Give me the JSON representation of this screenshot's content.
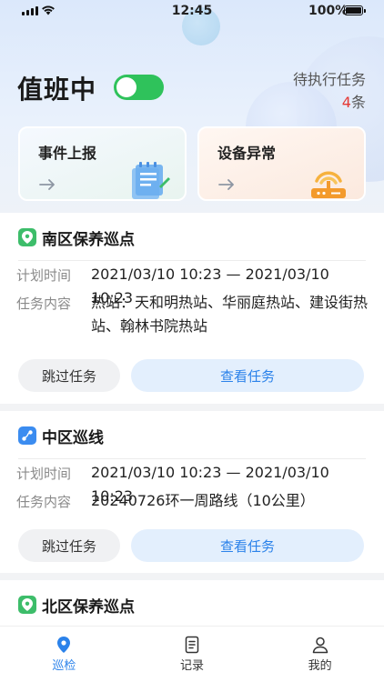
{
  "status_bar": {
    "time": "12:45",
    "battery": "100%"
  },
  "header": {
    "duty_label": "值班中",
    "duty_on": true,
    "pending_label": "待执行任务",
    "pending_count": "4",
    "pending_unit": "条"
  },
  "quick_actions": [
    {
      "label": "事件上报",
      "icon": "document-icon"
    },
    {
      "label": "设备异常",
      "icon": "router-icon"
    }
  ],
  "tasks": [
    {
      "title": "南区保养巡点",
      "icon": "map-pin-icon",
      "plan_time_label": "计划时间",
      "plan_time": "2021/03/10 10:23 — 2021/03/10 10:23",
      "content_label": "任务内容",
      "content": "热站：天和明热站、华丽庭热站、建设街热站、翰林书院热站",
      "skip_label": "跳过任务",
      "view_label": "查看任务"
    },
    {
      "title": "中区巡线",
      "icon": "route-icon",
      "plan_time_label": "计划时间",
      "plan_time": "2021/03/10 10:23 — 2021/03/10 10:23",
      "content_label": "任务内容",
      "content": "20240726环一周路线（10公里）",
      "skip_label": "跳过任务",
      "view_label": "查看任务"
    },
    {
      "title": "北区保养巡点",
      "icon": "map-pin-icon"
    }
  ],
  "tabbar": [
    {
      "label": "巡检",
      "active": true
    },
    {
      "label": "记录",
      "active": false
    },
    {
      "label": "我的",
      "active": false
    }
  ],
  "colors": {
    "accent": "#2b82ea",
    "toggle_on": "#2fc25b",
    "pending_count": "#e53935"
  }
}
